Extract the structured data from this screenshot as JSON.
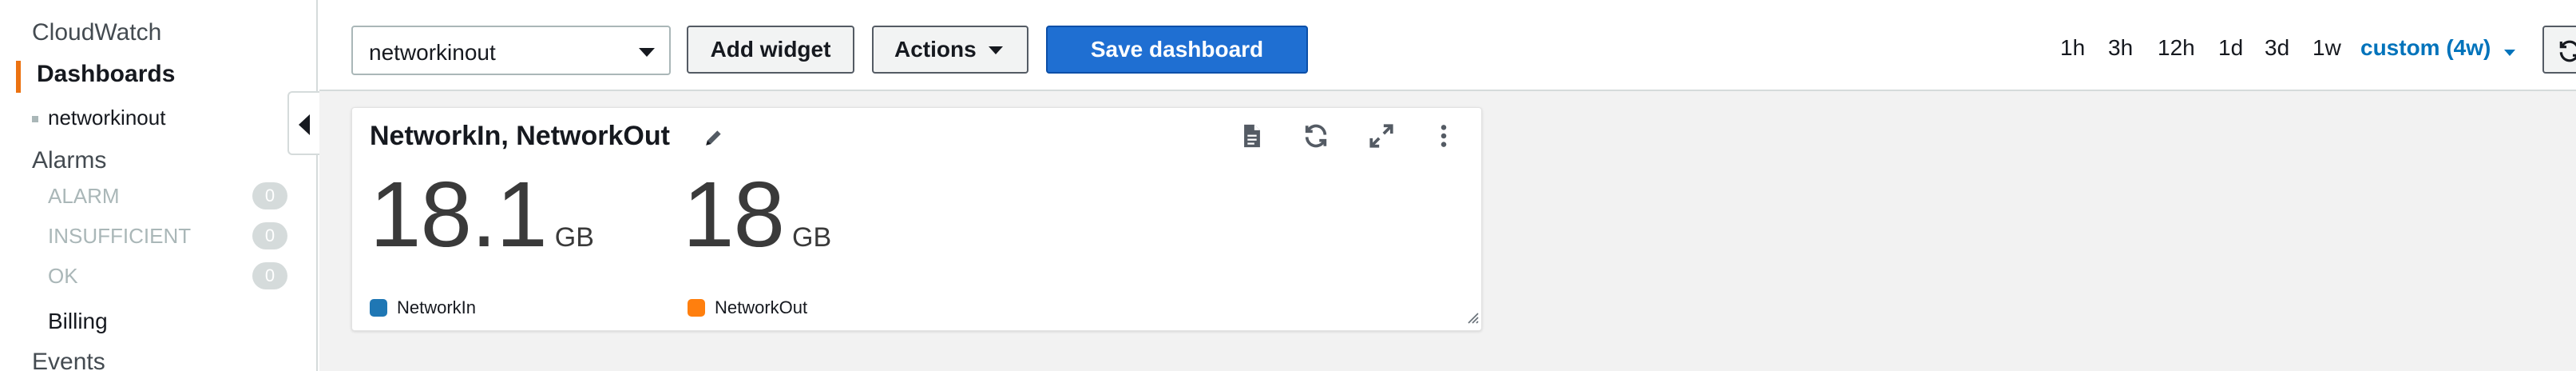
{
  "sidebar": {
    "service": "CloudWatch",
    "active_section": "Dashboards",
    "dashboard_item": "networkinout",
    "alarms_label": "Alarms",
    "alarm_states": [
      {
        "label": "ALARM",
        "count": "0"
      },
      {
        "label": "INSUFFICIENT",
        "count": "0"
      },
      {
        "label": "OK",
        "count": "0"
      }
    ],
    "billing_label": "Billing",
    "events_label": "Events"
  },
  "toolbar": {
    "dashboard_select_value": "networkinout",
    "add_widget_label": "Add widget",
    "actions_label": "Actions",
    "save_label": "Save dashboard",
    "time_ranges": [
      "1h",
      "3h",
      "12h",
      "1d",
      "3d",
      "1w"
    ],
    "custom_range_label": "custom (4w)"
  },
  "widget": {
    "title": "NetworkIn, NetworkOut",
    "metrics": [
      {
        "name": "NetworkIn",
        "value": "18.1",
        "unit": "GB",
        "color": "#1f77b4"
      },
      {
        "name": "NetworkOut",
        "value": "18",
        "unit": "GB",
        "color": "#ff7f0e"
      }
    ]
  },
  "colors": {
    "accent_orange": "#ec7211",
    "primary_blue": "#1f6fd2",
    "link_blue": "#0073bb"
  }
}
